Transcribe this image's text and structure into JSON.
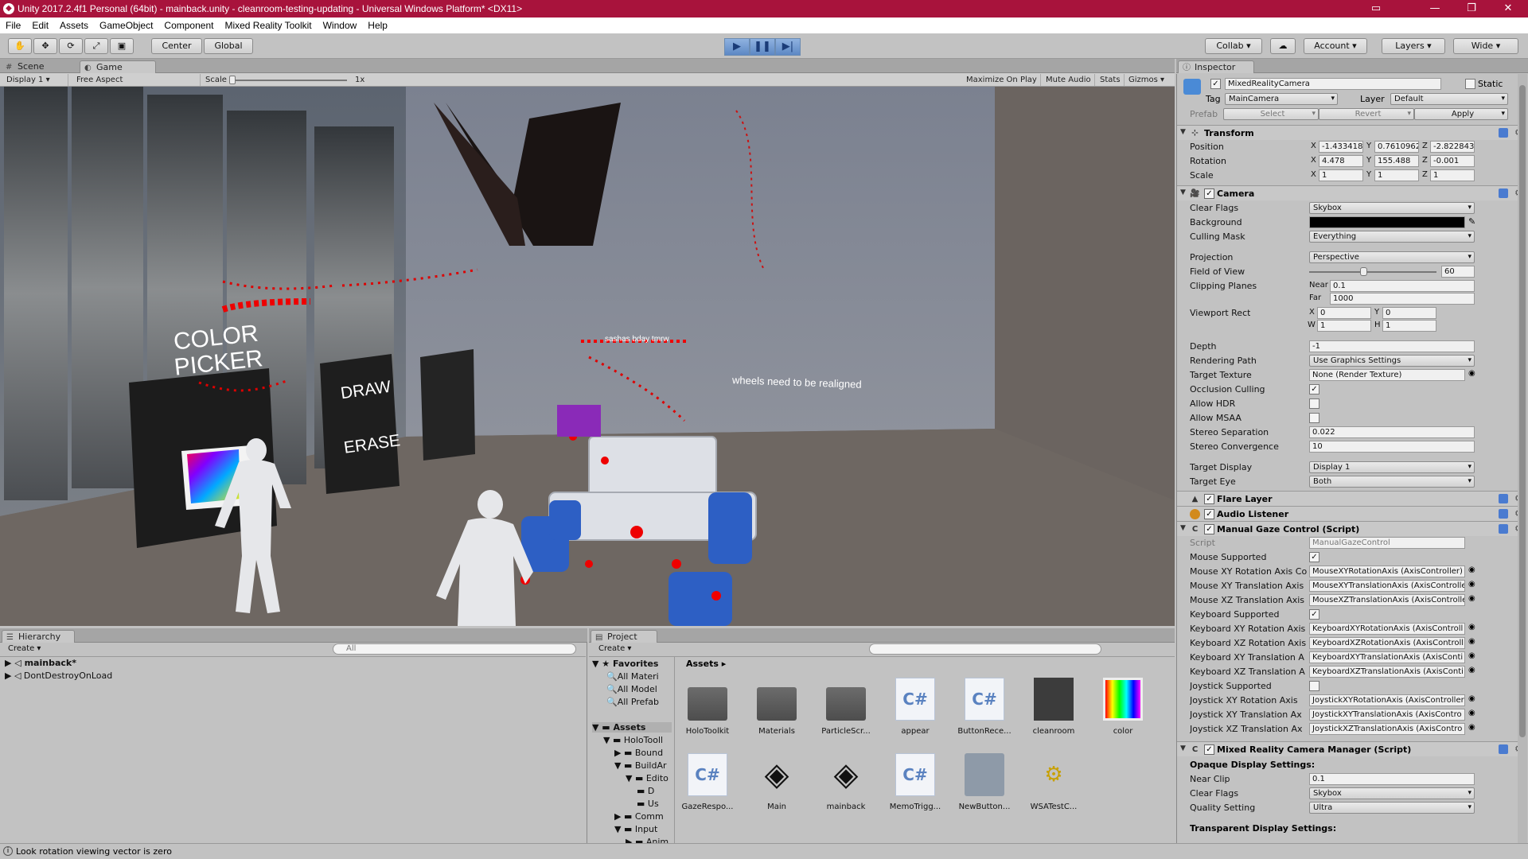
{
  "window": {
    "title": "Unity 2017.2.4f1 Personal (64bit) - mainback.unity - cleanroom-testing-updating - Universal Windows Platform* <DX11>"
  },
  "menu": [
    "File",
    "Edit",
    "Assets",
    "GameObject",
    "Component",
    "Mixed Reality Toolkit",
    "Window",
    "Help"
  ],
  "toolbar": {
    "pivot": "Center",
    "space": "Global",
    "collab": "Collab",
    "account": "Account",
    "layers": "Layers",
    "layout": "Wide"
  },
  "tabs": {
    "scene": "Scene",
    "game": "Game"
  },
  "gamebar": {
    "display": "Display 1",
    "aspect": "Free Aspect",
    "scale_label": "Scale",
    "scale_value": "1x",
    "maximize": "Maximize On Play",
    "mute": "Mute Audio",
    "stats": "Stats",
    "gizmos": "Gizmos"
  },
  "scene_text": {
    "color_picker_1": "COLOR",
    "color_picker_2": "PICKER",
    "draw": "DRAW",
    "erase": "ERASE",
    "note1": "sashas bday tmrw",
    "note2": "wheels need to be realigned"
  },
  "inspector": {
    "tab": "Inspector",
    "object_name": "MixedRealityCamera",
    "static": "Static",
    "tag_label": "Tag",
    "tag": "MainCamera",
    "layer_label": "Layer",
    "layer": "Default",
    "prefab": "Prefab",
    "select": "Select",
    "revert": "Revert",
    "apply": "Apply",
    "transform": {
      "title": "Transform",
      "position": {
        "label": "Position",
        "x": "-1.433418",
        "y": "0.7610962",
        "z": "-2.822843"
      },
      "rotation": {
        "label": "Rotation",
        "x": "4.478",
        "y": "155.488",
        "z": "-0.001"
      },
      "scale": {
        "label": "Scale",
        "x": "1",
        "y": "1",
        "z": "1"
      }
    },
    "camera": {
      "title": "Camera",
      "clear_flags": "Skybox",
      "background": "Background",
      "culling_mask": "Everything",
      "projection": "Perspective",
      "fov": "60",
      "near": "0.1",
      "far": "1000",
      "vp_x": "0",
      "vp_y": "0",
      "vp_w": "1",
      "vp_h": "1",
      "depth": "-1",
      "rendering_path": "Use Graphics Settings",
      "target_texture": "None (Render Texture)",
      "stereo_sep": "0.022",
      "stereo_conv": "10",
      "target_display": "Display 1",
      "target_eye": "Both",
      "labels": {
        "clear_flags": "Clear Flags",
        "culling": "Culling Mask",
        "projection": "Projection",
        "fov": "Field of View",
        "clipping": "Clipping Planes",
        "near": "Near",
        "far": "Far",
        "viewport": "Viewport Rect",
        "depth": "Depth",
        "rpath": "Rendering Path",
        "ttex": "Target Texture",
        "occl": "Occlusion Culling",
        "hdr": "Allow HDR",
        "msaa": "Allow MSAA",
        "ssep": "Stereo Separation",
        "sconv": "Stereo Convergence",
        "tdisp": "Target Display",
        "teye": "Target Eye"
      }
    },
    "flare": "Flare Layer",
    "audio": "Audio Listener",
    "gaze": {
      "title": "Manual Gaze Control (Script)",
      "script_label": "Script",
      "script": "ManualGazeControl",
      "rows": [
        {
          "label": "Mouse Supported",
          "type": "check"
        },
        {
          "label": "Mouse XY Rotation Axis Co",
          "value": "MouseXYRotationAxis (AxisController)"
        },
        {
          "label": "Mouse XY Translation Axis",
          "value": "MouseXYTranslationAxis (AxisControlle"
        },
        {
          "label": "Mouse XZ Translation Axis",
          "value": "MouseXZTranslationAxis (AxisControlle"
        },
        {
          "label": "Keyboard Supported",
          "type": "check"
        },
        {
          "label": "Keyboard XY Rotation Axis",
          "value": "KeyboardXYRotationAxis (AxisControll"
        },
        {
          "label": "Keyboard XZ Rotation Axis",
          "value": "KeyboardXZRotationAxis (AxisControll"
        },
        {
          "label": "Keyboard XY Translation A",
          "value": "KeyboardXYTranslationAxis (AxisConti"
        },
        {
          "label": "Keyboard XZ Translation A",
          "value": "KeyboardXZTranslationAxis (AxisConti"
        },
        {
          "label": "Joystick Supported",
          "type": "uncheck"
        },
        {
          "label": "Joystick XY Rotation Axis",
          "value": "JoystickXYRotationAxis (AxisController"
        },
        {
          "label": "Joystick XY Translation Ax",
          "value": "JoystickXYTranslationAxis (AxisContro"
        },
        {
          "label": "Joystick XZ Translation Ax",
          "value": "JoystickXZTranslationAxis (AxisContro"
        }
      ]
    },
    "mrcm": {
      "title": "Mixed Reality Camera Manager (Script)",
      "opaque": "Opaque Display Settings:",
      "near_clip_label": "Near Clip",
      "near_clip": "0.1",
      "clear_flags_label": "Clear Flags",
      "clear_flags": "Skybox",
      "quality_label": "Quality Setting",
      "quality": "Ultra",
      "transparent": "Transparent Display Settings:"
    }
  },
  "hierarchy": {
    "tab": "Hierarchy",
    "create": "Create",
    "search": "All",
    "items": [
      "mainback*",
      "DontDestroyOnLoad"
    ]
  },
  "project": {
    "tab": "Project",
    "create": "Create",
    "breadcrumb": "Assets",
    "favorites": "Favorites",
    "fav_items": [
      "All Materi",
      "All Model",
      "All Prefab"
    ],
    "assets_label": "Assets",
    "tree": [
      "HoloTooll",
      "Bound",
      "BuildAr",
      "Edito",
      "D",
      "Us",
      "Comm",
      "Input",
      "Anim"
    ],
    "assets": [
      "HoloToolkit",
      "Materials",
      "ParticleScr...",
      "appear",
      "ButtonRece...",
      "cleanroom",
      "color",
      "GazeRespo...",
      "Main",
      "mainback",
      "MemoTrigg...",
      "NewButton...",
      "WSATestC..."
    ]
  },
  "status": "Look rotation viewing vector is zero"
}
